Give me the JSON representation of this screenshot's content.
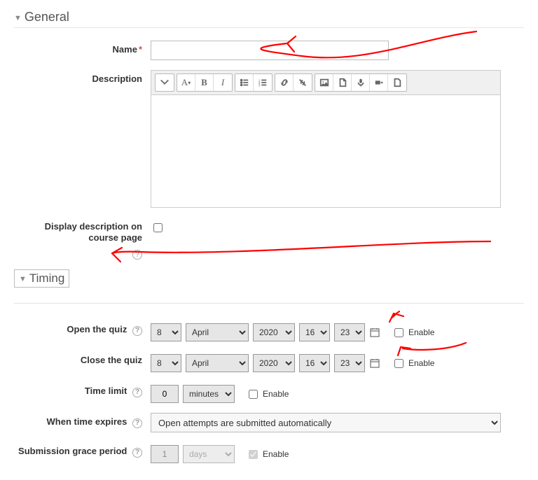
{
  "sections": {
    "general": {
      "title": "General"
    },
    "timing": {
      "title": "Timing"
    }
  },
  "labels": {
    "name": "Name",
    "description": "Description",
    "displayOnCourse": "Display description on course page",
    "openQuiz": "Open the quiz",
    "closeQuiz": "Close the quiz",
    "timeLimit": "Time limit",
    "whenExpires": "When time expires",
    "gracePeriod": "Submission grace period",
    "enable": "Enable"
  },
  "fields": {
    "name_value": "",
    "displayOnCourse_checked": false
  },
  "dates": {
    "open": {
      "day": "8",
      "month": "April",
      "year": "2020",
      "hour": "16",
      "min": "23",
      "enabled": false
    },
    "close": {
      "day": "8",
      "month": "April",
      "year": "2020",
      "hour": "16",
      "min": "23",
      "enabled": false
    }
  },
  "timeLimit": {
    "value": "0",
    "unit": "minutes",
    "enabled": false
  },
  "whenExpires": {
    "selected": "Open attempts are submitted automatically"
  },
  "gracePeriod": {
    "value": "1",
    "unit": "days",
    "enabled": true
  }
}
